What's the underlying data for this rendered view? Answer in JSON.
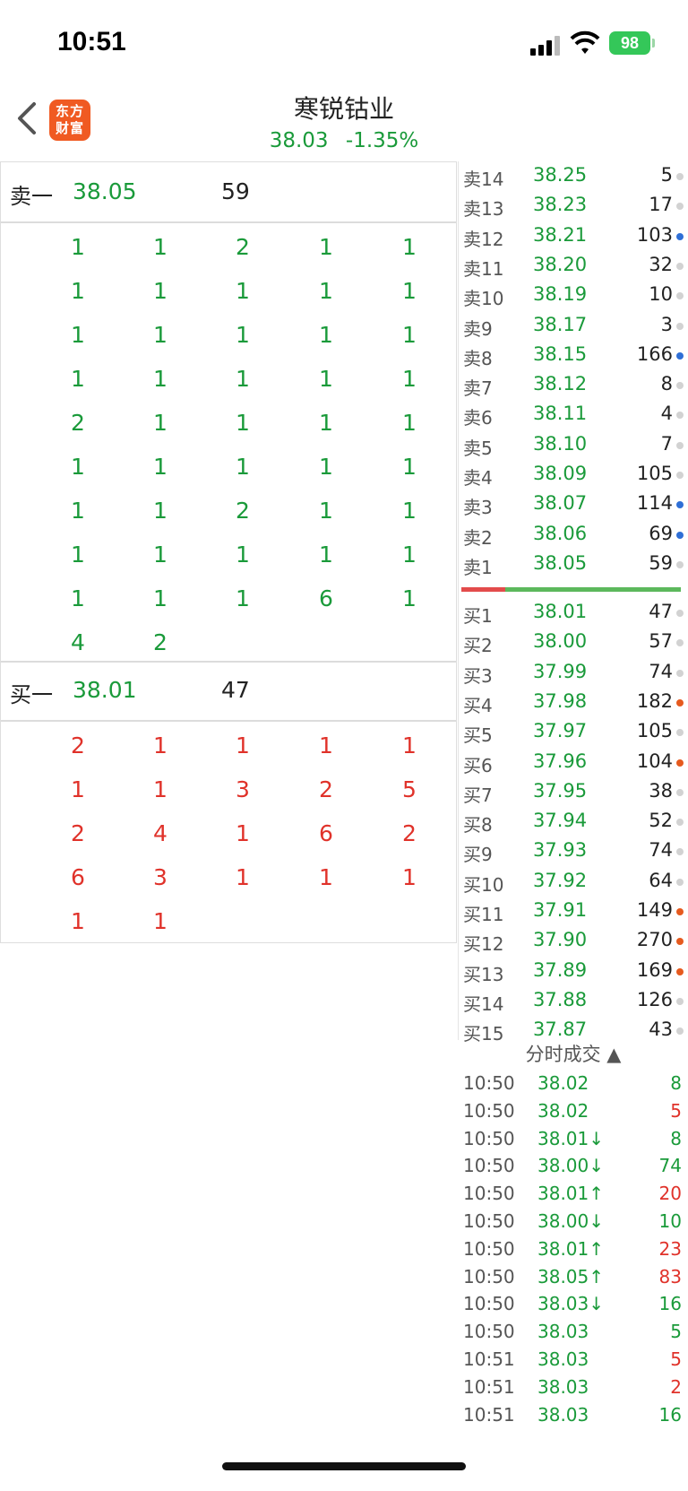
{
  "status": {
    "time": "10:51",
    "battery": "98"
  },
  "nav": {
    "title": "寒锐钴业",
    "price": "38.03",
    "change": "-1.35%",
    "logo_line1": "东方",
    "logo_line2": "财富"
  },
  "ask1": {
    "label": "卖一",
    "price": "38.05",
    "volume": "59",
    "orders": [
      "1",
      "1",
      "2",
      "1",
      "1",
      "1",
      "1",
      "1",
      "1",
      "1",
      "1",
      "1",
      "1",
      "1",
      "1",
      "1",
      "1",
      "1",
      "1",
      "1",
      "2",
      "1",
      "1",
      "1",
      "1",
      "1",
      "1",
      "1",
      "1",
      "1",
      "1",
      "1",
      "2",
      "1",
      "1",
      "1",
      "1",
      "1",
      "1",
      "1",
      "1",
      "1",
      "1",
      "6",
      "1",
      "4",
      "2"
    ]
  },
  "bid1": {
    "label": "买一",
    "price": "38.01",
    "volume": "47",
    "orders": [
      "2",
      "1",
      "1",
      "1",
      "1",
      "1",
      "1",
      "3",
      "2",
      "5",
      "2",
      "4",
      "1",
      "6",
      "2",
      "6",
      "3",
      "1",
      "1",
      "1",
      "1",
      "1"
    ]
  },
  "asks": [
    {
      "label": "卖14",
      "price": "38.25",
      "volume": "5",
      "dot": "gray"
    },
    {
      "label": "卖13",
      "price": "38.23",
      "volume": "17",
      "dot": "gray"
    },
    {
      "label": "卖12",
      "price": "38.21",
      "volume": "103",
      "dot": "blue"
    },
    {
      "label": "卖11",
      "price": "38.20",
      "volume": "32",
      "dot": "gray"
    },
    {
      "label": "卖10",
      "price": "38.19",
      "volume": "10",
      "dot": "gray"
    },
    {
      "label": "卖9",
      "price": "38.17",
      "volume": "3",
      "dot": "gray"
    },
    {
      "label": "卖8",
      "price": "38.15",
      "volume": "166",
      "dot": "blue"
    },
    {
      "label": "卖7",
      "price": "38.12",
      "volume": "8",
      "dot": "gray"
    },
    {
      "label": "卖6",
      "price": "38.11",
      "volume": "4",
      "dot": "gray"
    },
    {
      "label": "卖5",
      "price": "38.10",
      "volume": "7",
      "dot": "gray"
    },
    {
      "label": "卖4",
      "price": "38.09",
      "volume": "105",
      "dot": "gray"
    },
    {
      "label": "卖3",
      "price": "38.07",
      "volume": "114",
      "dot": "blue"
    },
    {
      "label": "卖2",
      "price": "38.06",
      "volume": "69",
      "dot": "blue"
    },
    {
      "label": "卖1",
      "price": "38.05",
      "volume": "59",
      "dot": "gray"
    }
  ],
  "bids": [
    {
      "label": "买1",
      "price": "38.01",
      "volume": "47",
      "dot": "gray"
    },
    {
      "label": "买2",
      "price": "38.00",
      "volume": "57",
      "dot": "gray"
    },
    {
      "label": "买3",
      "price": "37.99",
      "volume": "74",
      "dot": "gray"
    },
    {
      "label": "买4",
      "price": "37.98",
      "volume": "182",
      "dot": "orange"
    },
    {
      "label": "买5",
      "price": "37.97",
      "volume": "105",
      "dot": "gray"
    },
    {
      "label": "买6",
      "price": "37.96",
      "volume": "104",
      "dot": "orange"
    },
    {
      "label": "买7",
      "price": "37.95",
      "volume": "38",
      "dot": "gray"
    },
    {
      "label": "买8",
      "price": "37.94",
      "volume": "52",
      "dot": "gray"
    },
    {
      "label": "买9",
      "price": "37.93",
      "volume": "74",
      "dot": "gray"
    },
    {
      "label": "买10",
      "price": "37.92",
      "volume": "64",
      "dot": "gray"
    },
    {
      "label": "买11",
      "price": "37.91",
      "volume": "149",
      "dot": "orange"
    },
    {
      "label": "买12",
      "price": "37.90",
      "volume": "270",
      "dot": "orange"
    },
    {
      "label": "买13",
      "price": "37.89",
      "volume": "169",
      "dot": "orange"
    },
    {
      "label": "买14",
      "price": "37.88",
      "volume": "126",
      "dot": "gray"
    },
    {
      "label": "买15",
      "price": "37.87",
      "volume": "43",
      "dot": "gray"
    }
  ],
  "trades_header": "分时成交 ▲",
  "trades": [
    {
      "time": "10:50",
      "price": "38.02",
      "volume": "8",
      "vcolor": "green"
    },
    {
      "time": "10:50",
      "price": "38.02",
      "volume": "5",
      "vcolor": "red"
    },
    {
      "time": "10:50",
      "price": "38.01↓",
      "volume": "8",
      "vcolor": "green"
    },
    {
      "time": "10:50",
      "price": "38.00↓",
      "volume": "74",
      "vcolor": "green"
    },
    {
      "time": "10:50",
      "price": "38.01↑",
      "volume": "20",
      "vcolor": "red"
    },
    {
      "time": "10:50",
      "price": "38.00↓",
      "volume": "10",
      "vcolor": "green"
    },
    {
      "time": "10:50",
      "price": "38.01↑",
      "volume": "23",
      "vcolor": "red"
    },
    {
      "time": "10:50",
      "price": "38.05↑",
      "volume": "83",
      "vcolor": "red"
    },
    {
      "time": "10:50",
      "price": "38.03↓",
      "volume": "16",
      "vcolor": "green"
    },
    {
      "time": "10:50",
      "price": "38.03",
      "volume": "5",
      "vcolor": "green"
    },
    {
      "time": "10:51",
      "price": "38.03",
      "volume": "5",
      "vcolor": "red"
    },
    {
      "time": "10:51",
      "price": "38.03",
      "volume": "2",
      "vcolor": "red"
    },
    {
      "time": "10:51",
      "price": "38.03",
      "volume": "16",
      "vcolor": "green"
    }
  ],
  "colors": {
    "up": "#e0322a",
    "down": "#1a9a3a",
    "brand": "#f05a22"
  }
}
